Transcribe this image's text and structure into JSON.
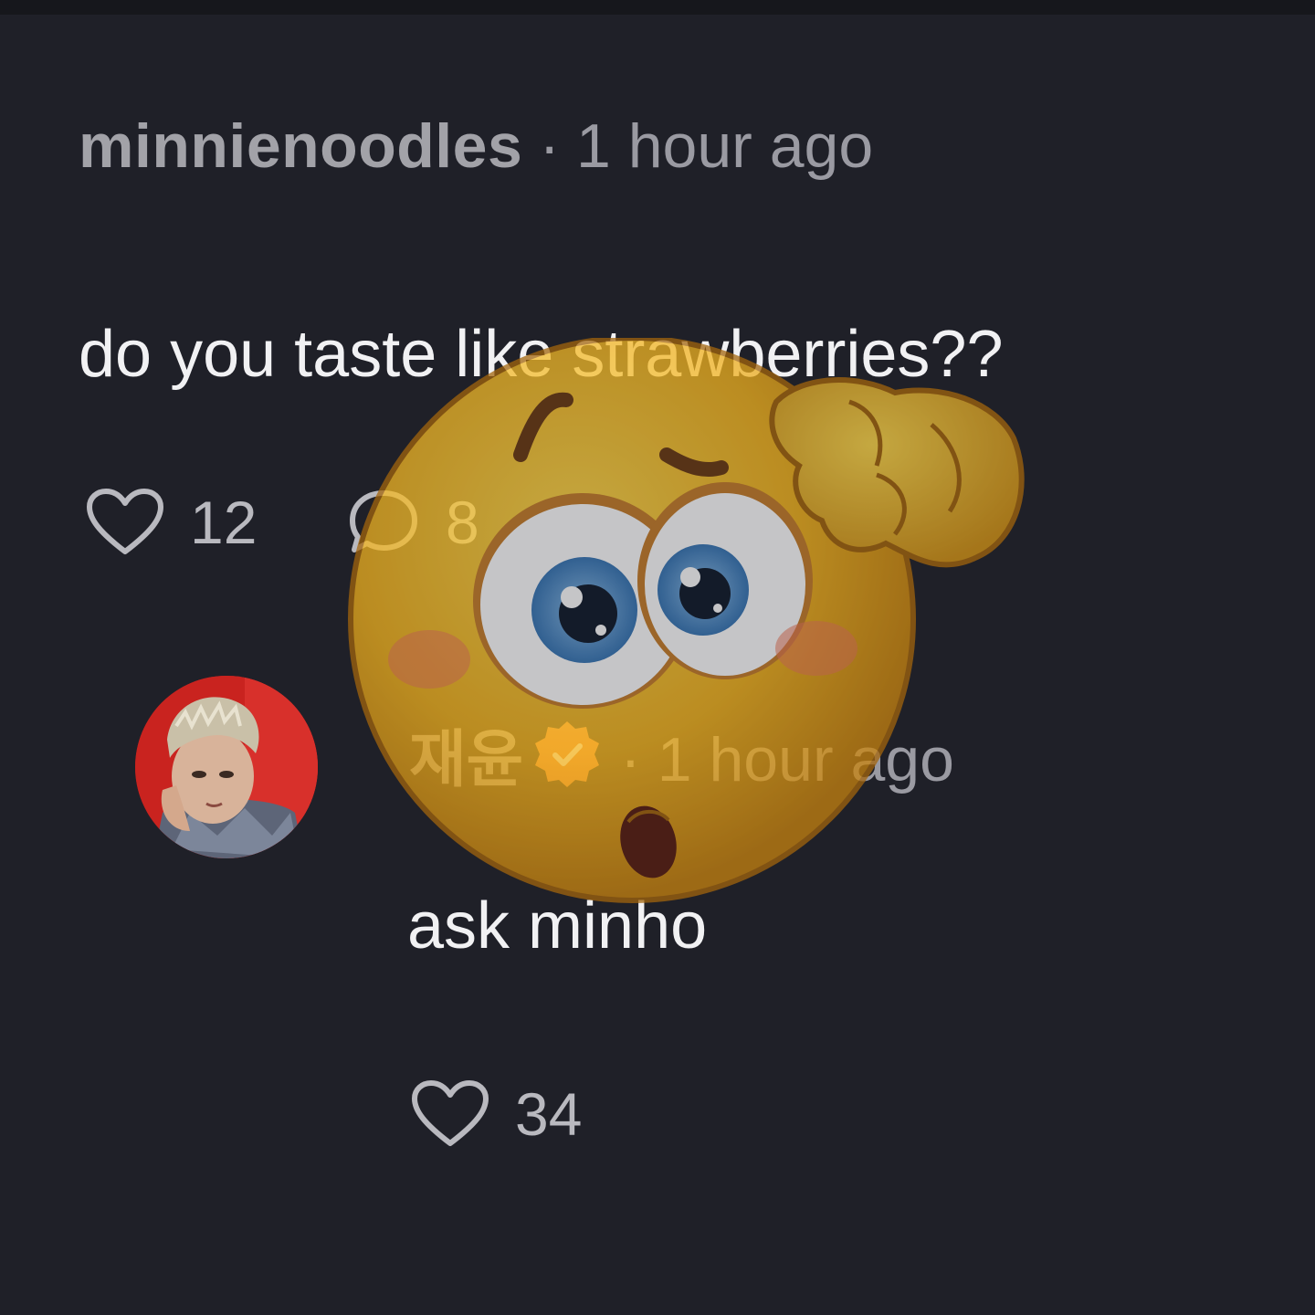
{
  "comment": {
    "username": "minnienoodles",
    "separator": "·",
    "time": "1 hour ago",
    "text": "do you taste like strawberries??",
    "like_count": "12",
    "reply_count": "8"
  },
  "reply": {
    "username": "재윤",
    "separator": "·",
    "time": "1 hour ago",
    "text": "ask minho",
    "like_count": "34",
    "verified_badge_color": "#f08a4b"
  },
  "icons": {
    "like": "heart-outline-icon",
    "reply": "speech-bubble-icon",
    "verified": "verified-badge-icon",
    "overlay": "confused-face-emoji-icon"
  },
  "colors": {
    "background": "#1f2028",
    "text": "#f1f1f3",
    "muted": "#9a9aa2"
  }
}
